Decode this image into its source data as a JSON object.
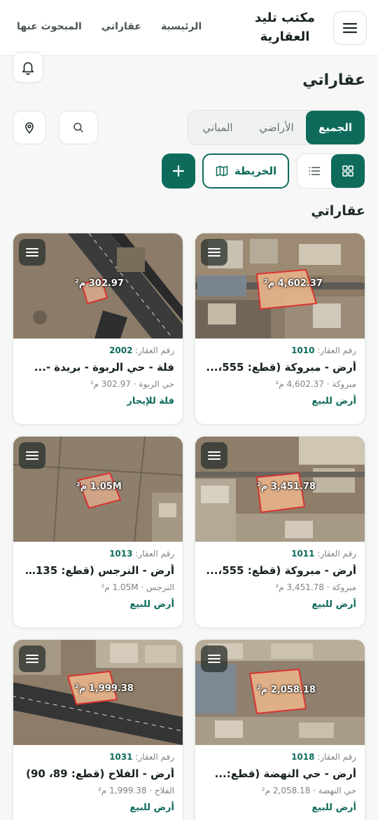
{
  "header": {
    "brand": "مكتب تليد العقارية",
    "nav": [
      "الرئيسية",
      "عقاراتي",
      "المبحوث عنها"
    ]
  },
  "page": {
    "title": "عقاراتي",
    "section_title": "عقاراتي"
  },
  "tabs": [
    "الجميع",
    "الأراضي",
    "المباني"
  ],
  "map_label": "الخريطة",
  "id_label": "رقم العقار:",
  "properties": [
    {
      "id": "1010",
      "title": "أرض - مبروكة (قطع: 555،...",
      "location": "مبروكة · 4,602.37 م²",
      "type": "أرض للبيع",
      "area_label": "4,602.37 م²"
    },
    {
      "id": "2002",
      "title": "فلة - حي الربوة - بريدة -...",
      "location": "حي الربوة · 302.97 م²",
      "type": "فلة للإيجار",
      "area_label": "302.97 م²"
    },
    {
      "id": "1011",
      "title": "أرض - مبروكة (قطع: 555،...",
      "location": "مبروكة · 3,451.78 م²",
      "type": "أرض للبيع",
      "area_label": "3,451.78 م²"
    },
    {
      "id": "1013",
      "title": "أرض - النرجس (قطع: 135،...",
      "location": "النرجس · 1.05M م²",
      "type": "أرض للبيع",
      "area_label": "1.05M م²"
    },
    {
      "id": "1018",
      "title": "أرض - حي النهضة (قطع:...",
      "location": "حي النهضة · 2,058.18 م²",
      "type": "أرض للبيع",
      "area_label": "2,058.18 م²"
    },
    {
      "id": "1031",
      "title": "أرض - الفلاح (قطع: 89، 90)",
      "location": "الفلاح · 1,999.38 م²",
      "type": "أرض للبيع",
      "area_label": "1,999.38 م²"
    }
  ]
}
